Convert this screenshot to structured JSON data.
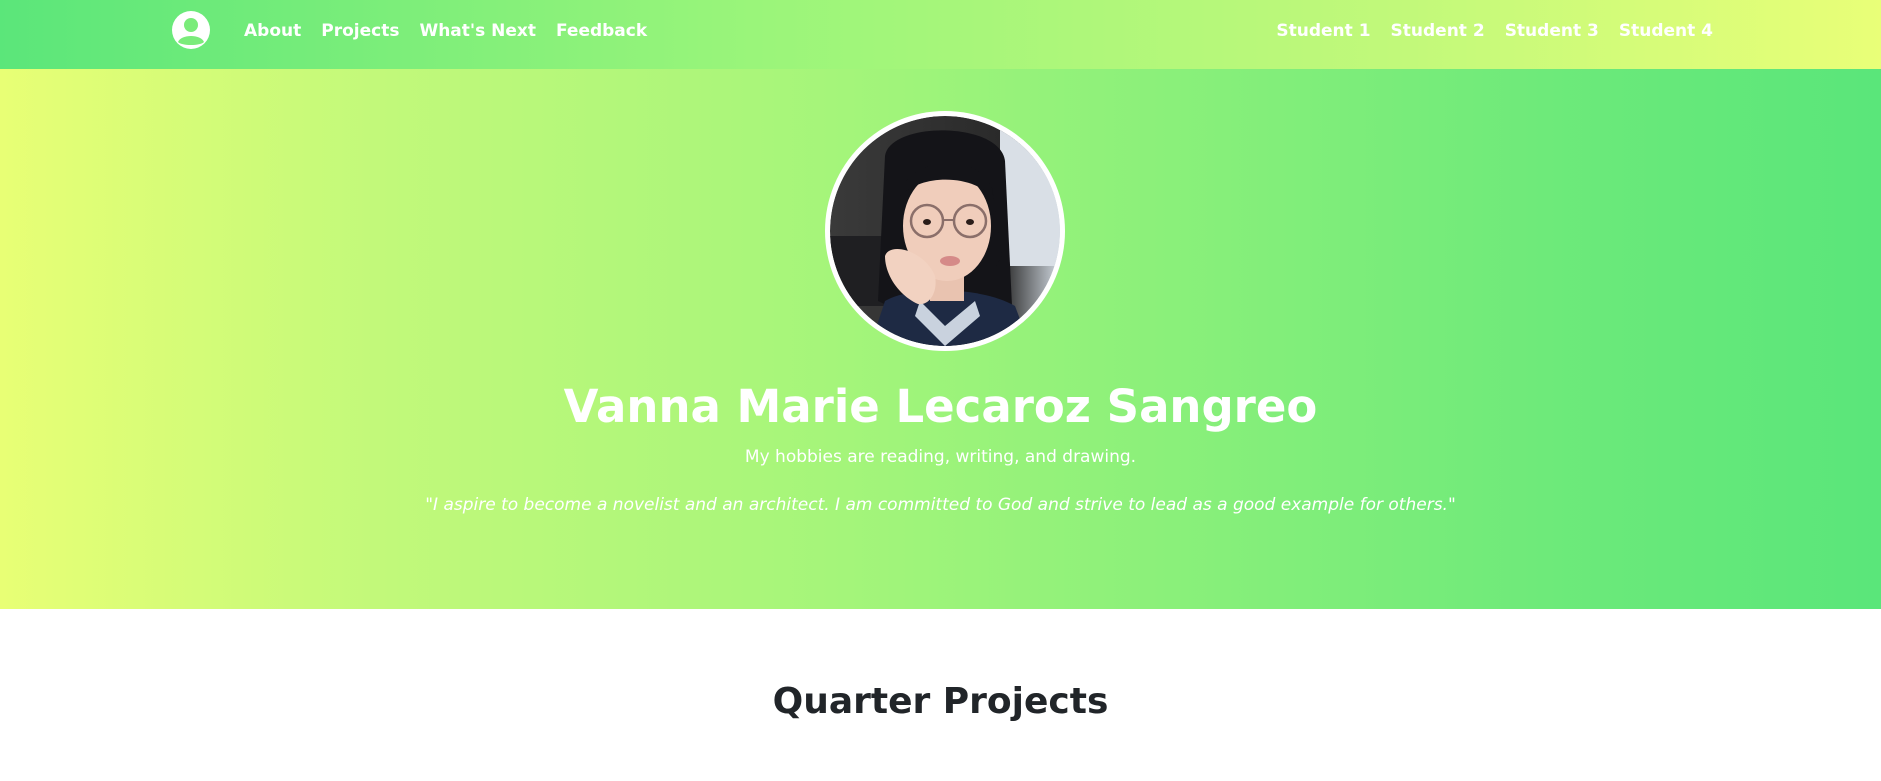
{
  "navbar": {
    "logo_icon": "user-circle-icon",
    "left_links": [
      {
        "label": "About"
      },
      {
        "label": "Projects"
      },
      {
        "label": "What's Next"
      },
      {
        "label": "Feedback"
      }
    ],
    "right_links": [
      {
        "label": "Student 1"
      },
      {
        "label": "Student 2"
      },
      {
        "label": "Student 3"
      },
      {
        "label": "Student 4"
      }
    ]
  },
  "hero": {
    "name": "Vanna Marie Lecaroz Sangreo",
    "hobbies": "My hobbies are reading, writing, and drawing.",
    "quote": "\"I aspire to become a novelist and an architect. I am committed to God and strive to lead as a good example for others.\""
  },
  "projects": {
    "title": "Quarter Projects"
  },
  "colors": {
    "gradient_green": "#5be67a",
    "gradient_yellow": "#e9ff78",
    "text_white": "#ffffff",
    "heading_dark": "#212529"
  }
}
